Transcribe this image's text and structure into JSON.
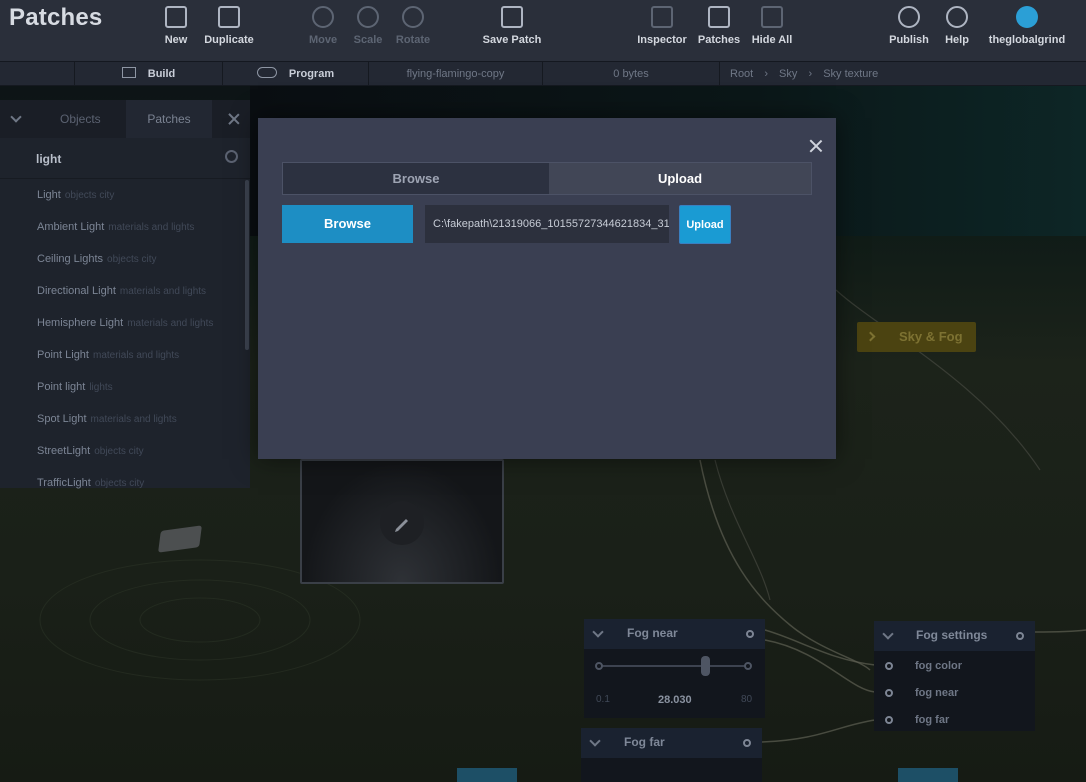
{
  "app": {
    "title": "Patches"
  },
  "toolbar": {
    "new": "New",
    "duplicate": "Duplicate",
    "move": "Move",
    "scale": "Scale",
    "rotate": "Rotate",
    "save_patch": "Save Patch",
    "inspector": "Inspector",
    "patches": "Patches",
    "hide_all": "Hide All",
    "publish": "Publish",
    "help": "Help",
    "user": "theglobalgrind"
  },
  "subbar": {
    "build": "Build",
    "program": "Program",
    "project_name": "flying-flamingo-copy",
    "size": "0 bytes",
    "breadcrumb": [
      "Root",
      "Sky",
      "Sky texture"
    ]
  },
  "left_panel": {
    "tabs": [
      "Objects",
      "Patches"
    ],
    "search_value": "light",
    "items": [
      {
        "name": "Light",
        "category": "objects city"
      },
      {
        "name": "Ambient Light",
        "category": "materials and lights"
      },
      {
        "name": "Ceiling Lights",
        "category": "objects city"
      },
      {
        "name": "Directional Light",
        "category": "materials and lights"
      },
      {
        "name": "Hemisphere Light",
        "category": "materials and lights"
      },
      {
        "name": "Point Light",
        "category": "materials and lights"
      },
      {
        "name": "Point light",
        "category": "lights"
      },
      {
        "name": "Spot Light",
        "category": "materials and lights"
      },
      {
        "name": "StreetLight",
        "category": "objects city"
      },
      {
        "name": "TrafficLight",
        "category": "objects city"
      }
    ]
  },
  "modal": {
    "tabs": [
      "Browse",
      "Upload"
    ],
    "active_tab": "Upload",
    "browse_button": "Browse",
    "file_path": "C:\\fakepath\\21319066_10155727344621834_31",
    "upload_button": "Upload"
  },
  "nodes": {
    "sky_fog": "Sky & Fog",
    "fog_near": {
      "title": "Fog near",
      "min": "0.1",
      "value": "28.030",
      "max": "80"
    },
    "fog_far": {
      "title": "Fog far"
    },
    "fog_settings": {
      "title": "Fog settings",
      "ports": [
        "fog color",
        "fog near",
        "fog far"
      ]
    }
  },
  "colors": {
    "toolbar_bg": "#2a2f3a",
    "modal_bg": "#3a3f52",
    "accent_blue": "#1d8ec4",
    "upload_blue": "#1a9bd3",
    "sky_node": "#4b4311"
  }
}
